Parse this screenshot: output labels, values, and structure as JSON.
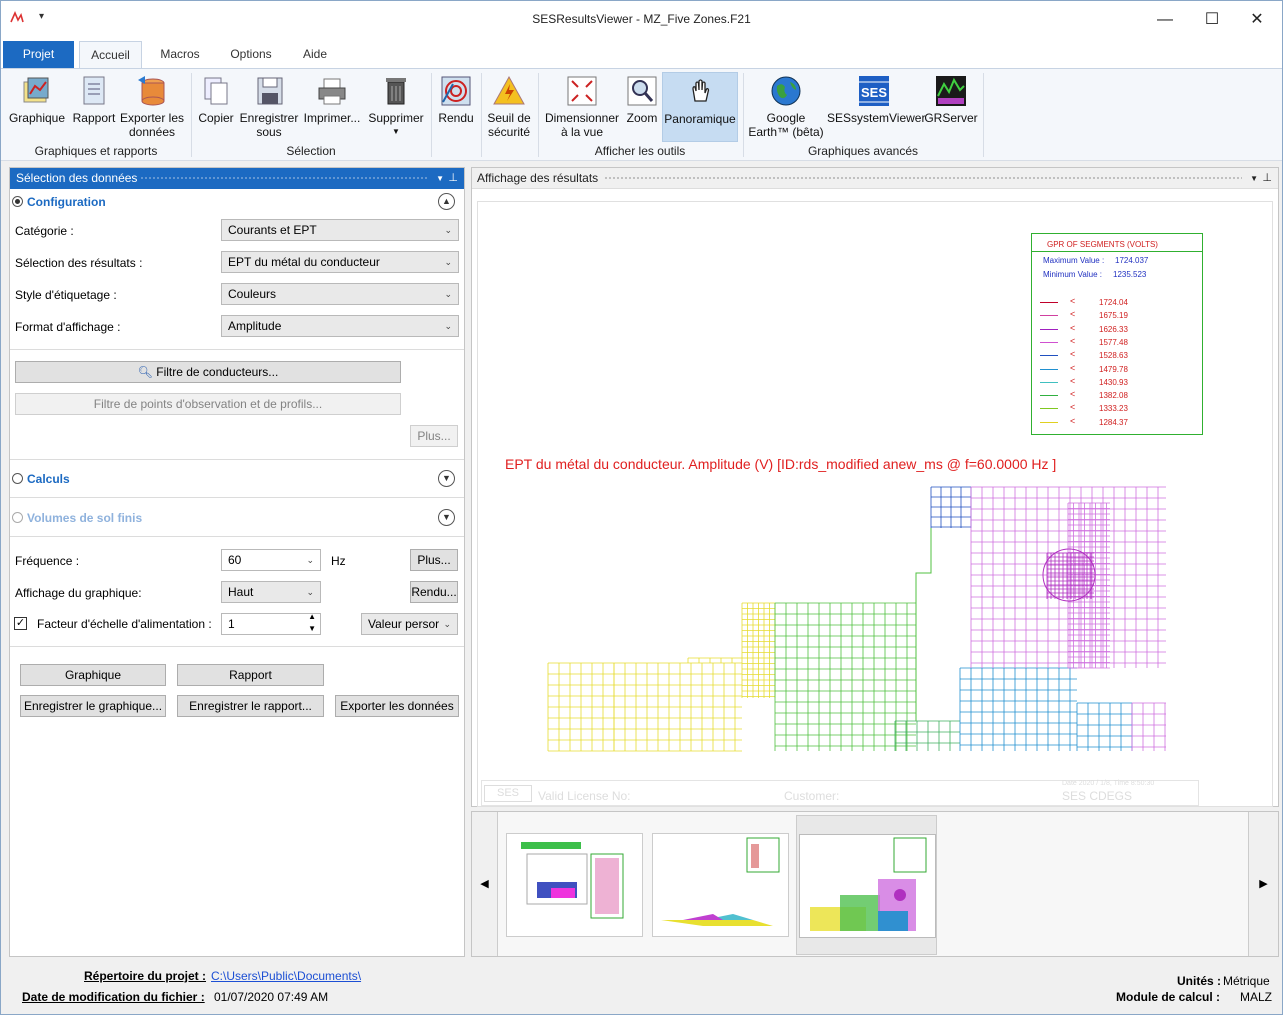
{
  "window": {
    "title": "SESResultsViewer - MZ_Five Zones.F21",
    "minimize": "—",
    "maximize": "☐",
    "close": "✕",
    "qa_arrow": "▾"
  },
  "tabs": [
    "Projet",
    "Accueil",
    "Macros",
    "Options",
    "Aide"
  ],
  "ribbon": {
    "buttons": [
      {
        "label": "Graphique",
        "icon": "chart-icon"
      },
      {
        "label": "Rapport",
        "icon": "report-icon"
      },
      {
        "label": "Exporter les données",
        "icon": "export-data-icon"
      },
      {
        "label": "Copier",
        "icon": "copy-icon"
      },
      {
        "label": "Enregistrer sous",
        "icon": "save-as-icon"
      },
      {
        "label": "Imprimer...",
        "icon": "printer-icon"
      },
      {
        "label": "Supprimer",
        "icon": "trash-icon"
      },
      {
        "label": "Rendu",
        "icon": "render-icon"
      },
      {
        "label": "Seuil de sécurité",
        "icon": "warning-icon"
      },
      {
        "label": "Dimensionner à la vue",
        "icon": "fit-view-icon"
      },
      {
        "label": "Zoom",
        "icon": "zoom-icon"
      },
      {
        "label": "Panoramique",
        "icon": "pan-hand-icon"
      },
      {
        "label": "Google Earth™ (bêta)",
        "icon": "globe-icon"
      },
      {
        "label": "SESsystemViewer",
        "icon": "ses-icon"
      },
      {
        "label": "GRServer",
        "icon": "grserver-icon"
      }
    ],
    "groups": [
      "Graphiques et rapports",
      "Sélection",
      "Afficher les outils",
      "Graphiques avancés"
    ]
  },
  "left_panel": {
    "title": "Sélection des données",
    "configuration": "Configuration",
    "rows": [
      {
        "label": "Catégorie :",
        "value": "Courants et EPT"
      },
      {
        "label": "Sélection des résultats :",
        "value": "EPT du métal du conducteur"
      },
      {
        "label": "Style d'étiquetage :",
        "value": "Couleurs"
      },
      {
        "label": "Format d'affichage :",
        "value": "Amplitude"
      }
    ],
    "filter_conductors": "Filtre de conducteurs...",
    "filter_points": "Filtre de points d'observation et de profils...",
    "more": "Plus...",
    "calculs": "Calculs",
    "volumes": "Volumes de sol finis",
    "frequency_label": "Fréquence :",
    "frequency_value": "60",
    "frequency_unit": "Hz",
    "frequency_more": "Plus...",
    "display_label": "Affichage du graphique:",
    "display_value": "Haut",
    "render_btn": "Rendu...",
    "scale_label": "Facteur d'échelle d'alimentation :",
    "scale_value": "1",
    "scale_mode": "Valeur persor",
    "graph_btn": "Graphique",
    "report_btn": "Rapport",
    "save_graph_btn": "Enregistrer le graphique...",
    "save_report_btn": "Enregistrer le rapport...",
    "export_btn": "Exporter les données"
  },
  "right_panel": {
    "title": "Affichage des résultats",
    "plot_title": "EPT du métal du conducteur. Amplitude (V) [ID:rds_modified anew_ms  @ f=60.0000 Hz ]",
    "legend": {
      "title": "GPR OF SEGMENTS (VOLTS)",
      "max_label": "Maximum Value :",
      "max_value": "1724.037",
      "min_label": "Minimum Value :",
      "min_value": "1235.523",
      "entries": [
        {
          "value": "1724.04",
          "color": "#c0002a"
        },
        {
          "value": "1675.19",
          "color": "#d040a0"
        },
        {
          "value": "1626.33",
          "color": "#a020c0"
        },
        {
          "value": "1577.48",
          "color": "#d050d0"
        },
        {
          "value": "1528.63",
          "color": "#2050c0"
        },
        {
          "value": "1479.78",
          "color": "#2090d0"
        },
        {
          "value": "1430.93",
          "color": "#40c0c0"
        },
        {
          "value": "1382.08",
          "color": "#30b040"
        },
        {
          "value": "1333.23",
          "color": "#80c820"
        },
        {
          "value": "1284.37",
          "color": "#e0d020"
        }
      ]
    },
    "footer": {
      "license": "Valid License No:",
      "customer": "Customer:",
      "company": "SES CDEGS",
      "date": "Date 2020 / 1/8, Time 8:50:30"
    }
  },
  "thumbs": {
    "left_arrow": "◀",
    "right_arrow": "▶"
  },
  "status": {
    "project_dir_label": "Répertoire du projet :",
    "project_dir": "C:\\Users\\Public\\Documents\\",
    "modified_label": "Date de modification du fichier :",
    "modified_value": "01/07/2020  07:49 AM",
    "units_label": "Unités :",
    "units_value": "Métrique",
    "module_label": "Module de calcul :",
    "module_value": "MALZ"
  }
}
